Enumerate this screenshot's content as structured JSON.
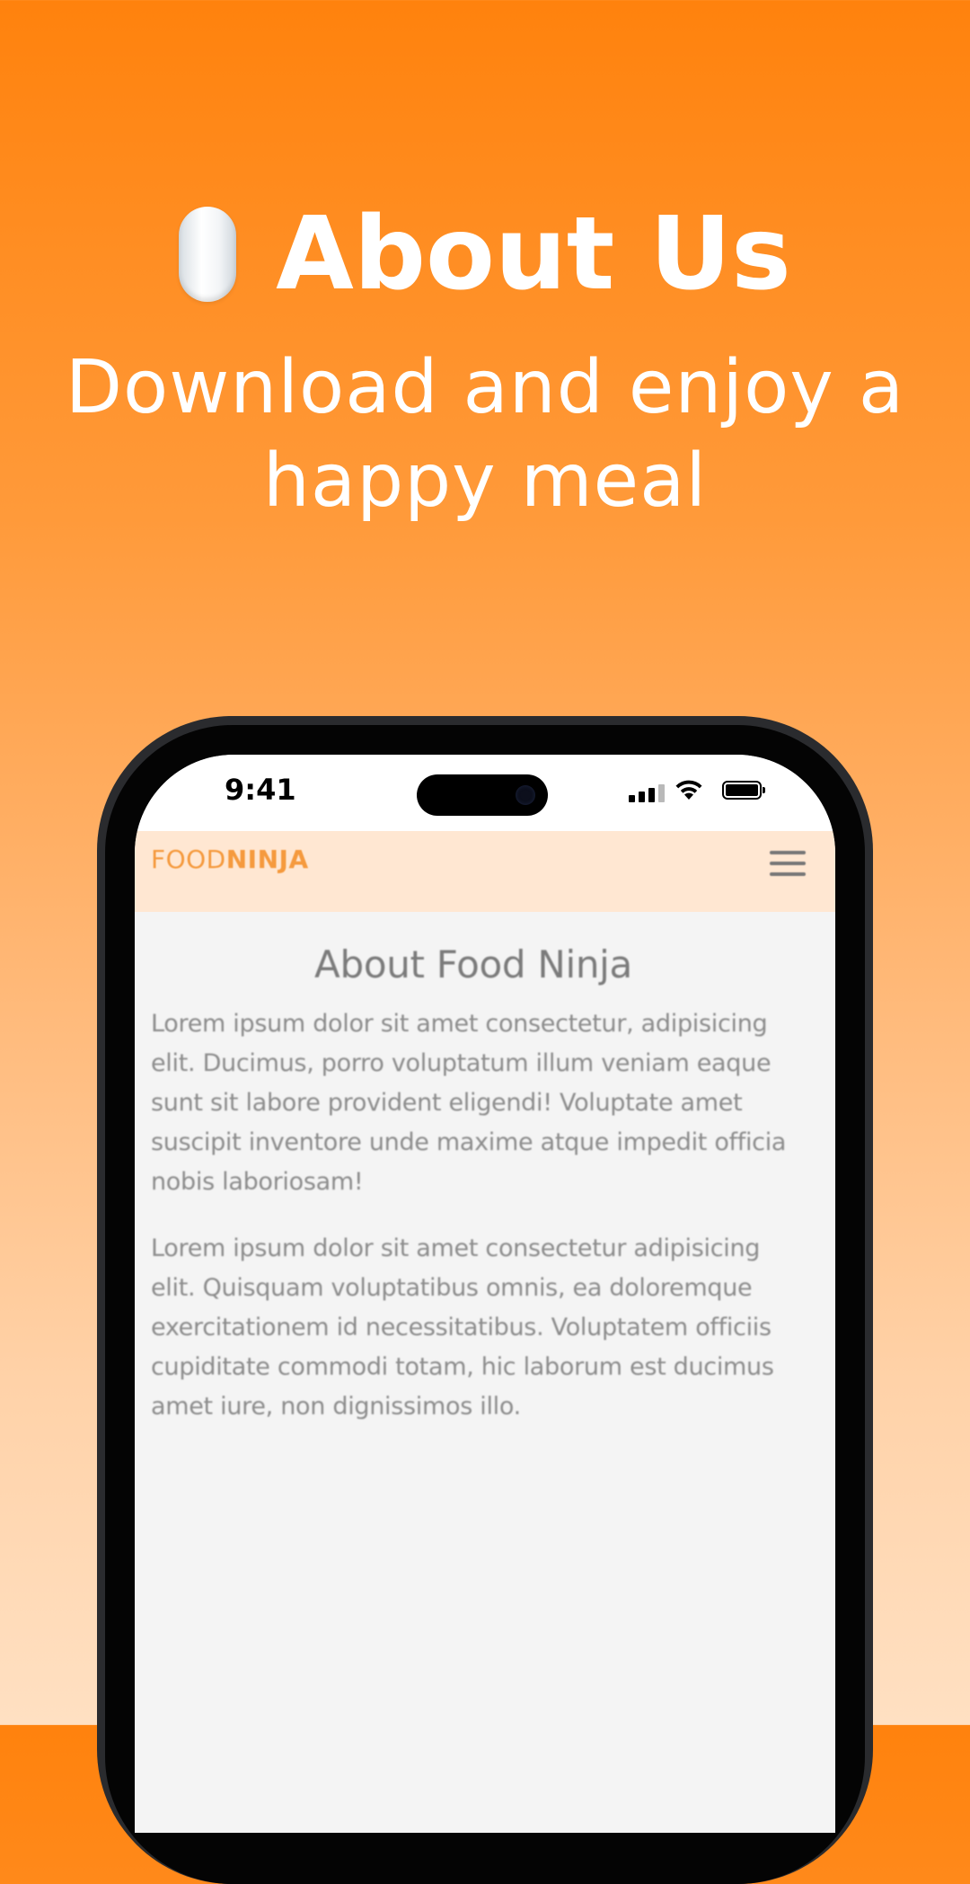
{
  "hero": {
    "icon": "mouse-icon",
    "title": "About Us",
    "subtitle": "Download and enjoy a happy meal"
  },
  "status_bar": {
    "time": "9:41",
    "icons": [
      "cellular-signal-icon",
      "wifi-icon",
      "battery-icon"
    ]
  },
  "app": {
    "brand_light": "FOOD",
    "brand_bold": "NINJA",
    "menu_icon": "hamburger-menu-icon",
    "page_title": "About Food Ninja",
    "paragraphs": [
      "Lorem ipsum dolor sit amet consectetur, adipisicing elit. Ducimus, porro voluptatum illum veniam eaque sunt sit labore provident eligendi! Voluptate amet suscipit inventore unde maxime atque impedit officia nobis laboriosam!",
      "Lorem ipsum dolor sit amet consectetur adipisicing elit. Quisquam voluptatibus omnis, ea doloremque exercitationem id necessitatibus. Voluptatem officiis cupiditate commodi totam, hic laborum est ducimus amet iure, non dignissimos illo."
    ]
  },
  "colors": {
    "background_top": "#ff820d",
    "background_bottom": "#ffe0c2",
    "nav_background": "#ffe7d2",
    "brand": "#f59a3e"
  }
}
